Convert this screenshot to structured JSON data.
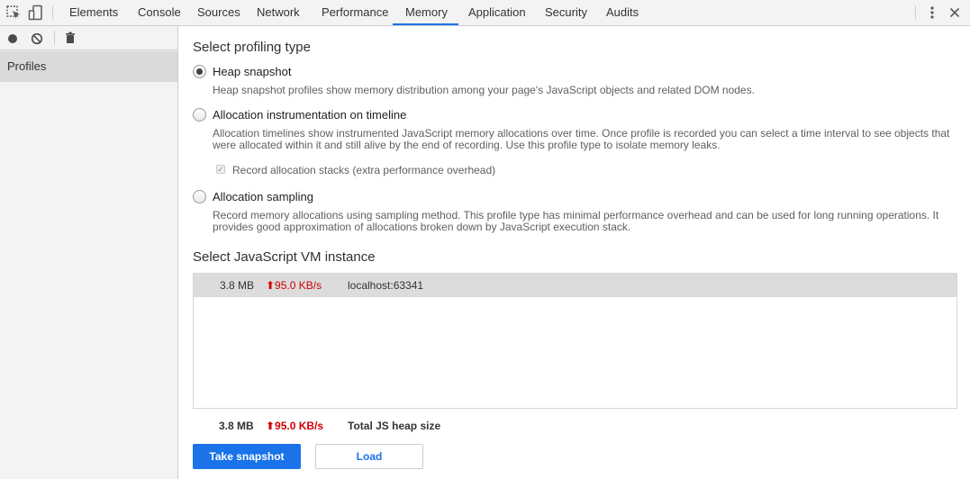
{
  "toolbar": {
    "icons": [
      "inspect-element-icon",
      "device-toolbar-icon"
    ],
    "tabs": [
      {
        "label": "Elements"
      },
      {
        "label": "Console"
      },
      {
        "label": "Sources"
      },
      {
        "label": "Network"
      },
      {
        "label": "Performance"
      },
      {
        "label": "Memory",
        "active": true
      },
      {
        "label": "Application"
      },
      {
        "label": "Security"
      },
      {
        "label": "Audits"
      }
    ],
    "accent_color": "#1a73e8"
  },
  "sidebar": {
    "icons": [
      "record-icon",
      "clear-icon",
      "trash-icon"
    ],
    "items": [
      {
        "label": "Profiles",
        "selected": true
      }
    ]
  },
  "main": {
    "profiling_title": "Select profiling type",
    "options": [
      {
        "label": "Heap snapshot",
        "checked": true,
        "description": "Heap snapshot profiles show memory distribution among your page's JavaScript objects and related DOM nodes."
      },
      {
        "label": "Allocation instrumentation on timeline",
        "checked": false,
        "description": "Allocation timelines show instrumented JavaScript memory allocations over time. Once profile is recorded you can select a time interval to see objects that were allocated within it and still alive by the end of recording. Use this profile type to isolate memory leaks.",
        "checkbox_label": "Record allocation stacks (extra performance overhead)",
        "checkbox_checked": true
      },
      {
        "label": "Allocation sampling",
        "checked": false,
        "description": "Record memory allocations using sampling method. This profile type has minimal performance overhead and can be used for long running operations. It provides good approximation of allocations broken down by JavaScript execution stack."
      }
    ],
    "vm_title": "Select JavaScript VM instance",
    "vm_instances": [
      {
        "size": "3.8 MB",
        "rate": "⬆95.0 KB/s",
        "name": "localhost:63341"
      }
    ],
    "summary": {
      "size": "3.8 MB",
      "rate": "⬆95.0 KB/s",
      "label": "Total JS heap size"
    },
    "buttons": {
      "take_snapshot": "Take snapshot",
      "load": "Load"
    },
    "rate_color": "#d00000"
  }
}
